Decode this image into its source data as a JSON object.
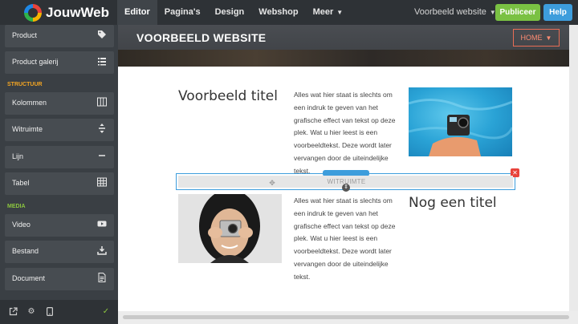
{
  "topbar": {
    "brand": "JouwWeb",
    "nav": [
      {
        "label": "Editor",
        "active": true
      },
      {
        "label": "Pagina's"
      },
      {
        "label": "Design"
      },
      {
        "label": "Webshop"
      },
      {
        "label": "Meer"
      }
    ],
    "site_select": "Voorbeeld website",
    "publish_label": "Publiceer",
    "help_label": "Help"
  },
  "sidebar": {
    "items_top": [
      {
        "label": "Product",
        "icon": "tag-icon"
      },
      {
        "label": "Product galerij",
        "icon": "list-icon"
      }
    ],
    "section_structure": "STRUCTUUR",
    "items_structure": [
      {
        "label": "Kolommen",
        "icon": "columns-icon"
      },
      {
        "label": "Witruimte",
        "icon": "spacing-icon"
      },
      {
        "label": "Lijn",
        "icon": "line-icon"
      },
      {
        "label": "Tabel",
        "icon": "table-icon"
      }
    ],
    "section_media": "MEDIA",
    "items_media": [
      {
        "label": "Video",
        "icon": "video-icon"
      },
      {
        "label": "Bestand",
        "icon": "download-icon"
      },
      {
        "label": "Document",
        "icon": "document-icon"
      }
    ],
    "section_colors": {
      "structure": "#f5a623",
      "media": "#8cc63f"
    }
  },
  "site": {
    "title": "VOORBEELD WEBSITE",
    "home_label": "HOME",
    "heading1": "Voorbeeld titel",
    "heading2": "Nog een titel",
    "paragraph1": "Alles wat hier staat is slechts om een indruk te geven van het grafische effect van tekst op deze plek. Wat u hier leest is een voorbeeldtekst. Deze wordt later vervangen door de uiteindelijke tekst.",
    "paragraph2": "Alles wat hier staat is slechts om een indruk te geven van het grafische effect van tekst op deze plek. Wat u hier leest is een voorbeeldtekst. Deze wordt later vervangen door de uiteindelijke tekst."
  },
  "selection": {
    "label": "WITRUIMTE"
  },
  "colors": {
    "accent_blue": "#3d9ddc",
    "publish_green": "#7ac143",
    "home_orange": "#e86d55"
  }
}
